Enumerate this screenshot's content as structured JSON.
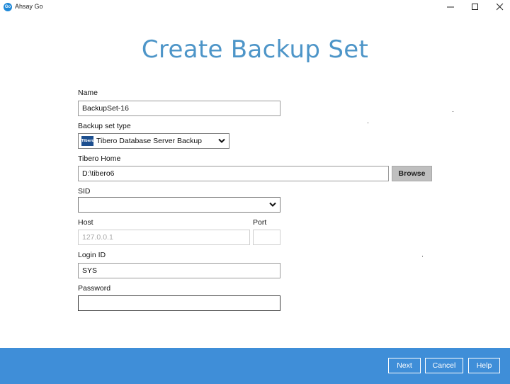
{
  "window": {
    "app_logo_text": "Go",
    "app_title": "Ahsay Go"
  },
  "page": {
    "title": "Create Backup Set"
  },
  "form": {
    "name_label": "Name",
    "name_value": "BackupSet-16",
    "type_label": "Backup set type",
    "type_logo_text": "Tibero",
    "type_value": "Tibero Database Server Backup",
    "home_label": "Tibero Home",
    "home_value": "D:\\tibero6",
    "browse_label": "Browse",
    "sid_label": "SID",
    "sid_value": "",
    "host_label": "Host",
    "host_value": "127.0.0.1",
    "port_label": "Port",
    "port_value": "",
    "login_label": "Login ID",
    "login_value": "SYS",
    "password_label": "Password",
    "password_value": ""
  },
  "footer": {
    "next_label": "Next",
    "cancel_label": "Cancel",
    "help_label": "Help"
  },
  "colors": {
    "accent": "#3f8ed8",
    "title": "#4d95c8"
  }
}
